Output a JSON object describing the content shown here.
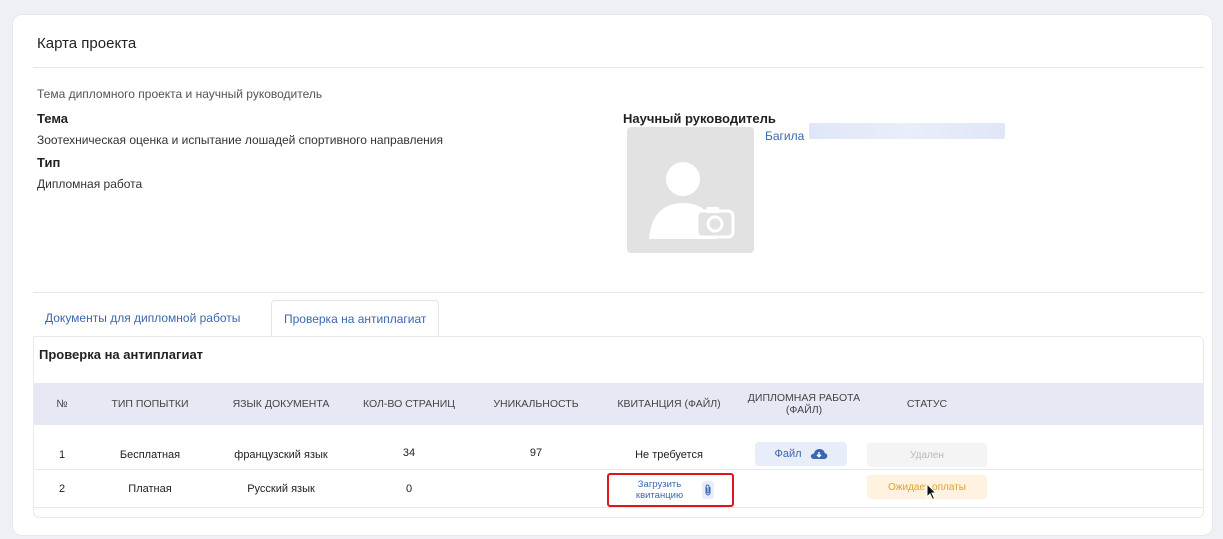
{
  "page": {
    "title": "Карта проекта"
  },
  "project": {
    "section_title": "Тема дипломного проекта и научный руководитель",
    "topic_label": "Тема",
    "topic_value": "Зоотехническая оценка и испытание лошадей спортивного направления",
    "type_label": "Тип",
    "type_value": "Дипломная работа",
    "supervisor_label": "Научный руководитель",
    "supervisor_name": "Багила"
  },
  "tabs": [
    {
      "label": "Документы для дипломной работы",
      "active": false
    },
    {
      "label": "Проверка на антиплагиат",
      "active": true
    }
  ],
  "antiplagiat": {
    "title": "Проверка на антиплагиат",
    "columns": [
      "№",
      "ТИП ПОПЫТКИ",
      "ЯЗЫК ДОКУМЕНТА",
      "КОЛ-ВО СТРАНИЦ",
      "УНИКАЛЬНОСТЬ",
      "КВИТАНЦИЯ (ФАЙЛ)",
      "ДИПЛОМНАЯ РАБОТА (ФАЙЛ)",
      "СТАТУС"
    ],
    "rows": [
      {
        "num": "1",
        "type": "Бесплатная",
        "language": "французский язык",
        "pages": "34",
        "uniqueness": "97",
        "receipt": "Не требуется",
        "thesis_file": "Файл",
        "status": "Удален"
      },
      {
        "num": "2",
        "type": "Платная",
        "language": "Русский язык",
        "pages": "0",
        "uniqueness": "",
        "receipt_action": "Загрузить квитанцию",
        "status": "Ожидает оплаты"
      }
    ]
  },
  "colors": {
    "accent": "#3b67b0",
    "highlight_border": "#e0151c",
    "status_waiting": "#e0a030",
    "header_bg": "#e6e9f3"
  }
}
